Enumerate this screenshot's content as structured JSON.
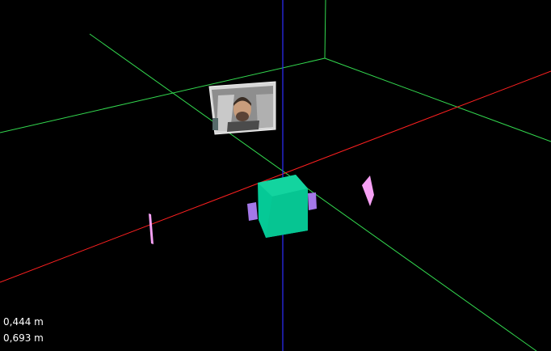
{
  "viewport": {
    "background_color": "#000000",
    "axis_colors": {
      "x_axis": "#ff2020",
      "z_axis": "#2d2dff",
      "grid": "#33d94f"
    },
    "object_colors": {
      "robot_body": "#05c996",
      "robot_wheels": "#a478e8",
      "markers": "#f7a1f5"
    },
    "camera_feed": {
      "label": "camera-feed"
    }
  },
  "readouts": {
    "first": "0,444 m",
    "second": "0,693 m"
  }
}
